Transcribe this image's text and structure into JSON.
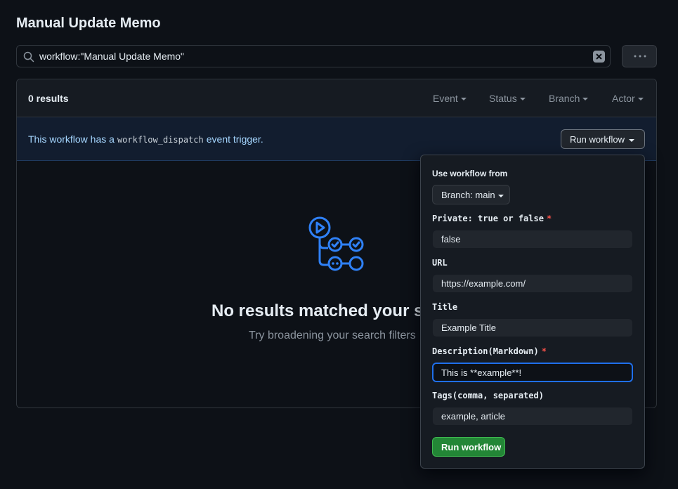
{
  "page": {
    "title": "Manual Update Memo"
  },
  "search": {
    "value": "workflow:\"Manual Update Memo\""
  },
  "results": {
    "count_label": "0 results",
    "filters": [
      "Event",
      "Status",
      "Branch",
      "Actor"
    ]
  },
  "dispatch": {
    "text_before": "This workflow has a",
    "code": "workflow_dispatch",
    "text_after": "event trigger.",
    "run_button_label": "Run workflow"
  },
  "empty_state": {
    "title": "No results matched your se",
    "subtitle": "Try broadening your search filters"
  },
  "run_form": {
    "use_from_label": "Use workflow from",
    "branch_label": "Branch: main",
    "fields": [
      {
        "label": "Private: true or false",
        "required": true,
        "value": "false"
      },
      {
        "label": "URL",
        "required": false,
        "value": "https://example.com/"
      },
      {
        "label": "Title",
        "required": false,
        "value": "Example Title"
      },
      {
        "label": "Description(Markdown)",
        "required": true,
        "value": "This is **example**!"
      },
      {
        "label": "Tags(comma, separated)",
        "required": false,
        "value": "example, article"
      }
    ],
    "submit_label": "Run workflow"
  },
  "colors": {
    "background": "#0d1117",
    "accent_blue": "#1f6feb",
    "success_green": "#238636",
    "required_red": "#f85149"
  },
  "icons": [
    "search-icon",
    "clear-icon",
    "kebab-icon",
    "workflow-graph-icon"
  ]
}
